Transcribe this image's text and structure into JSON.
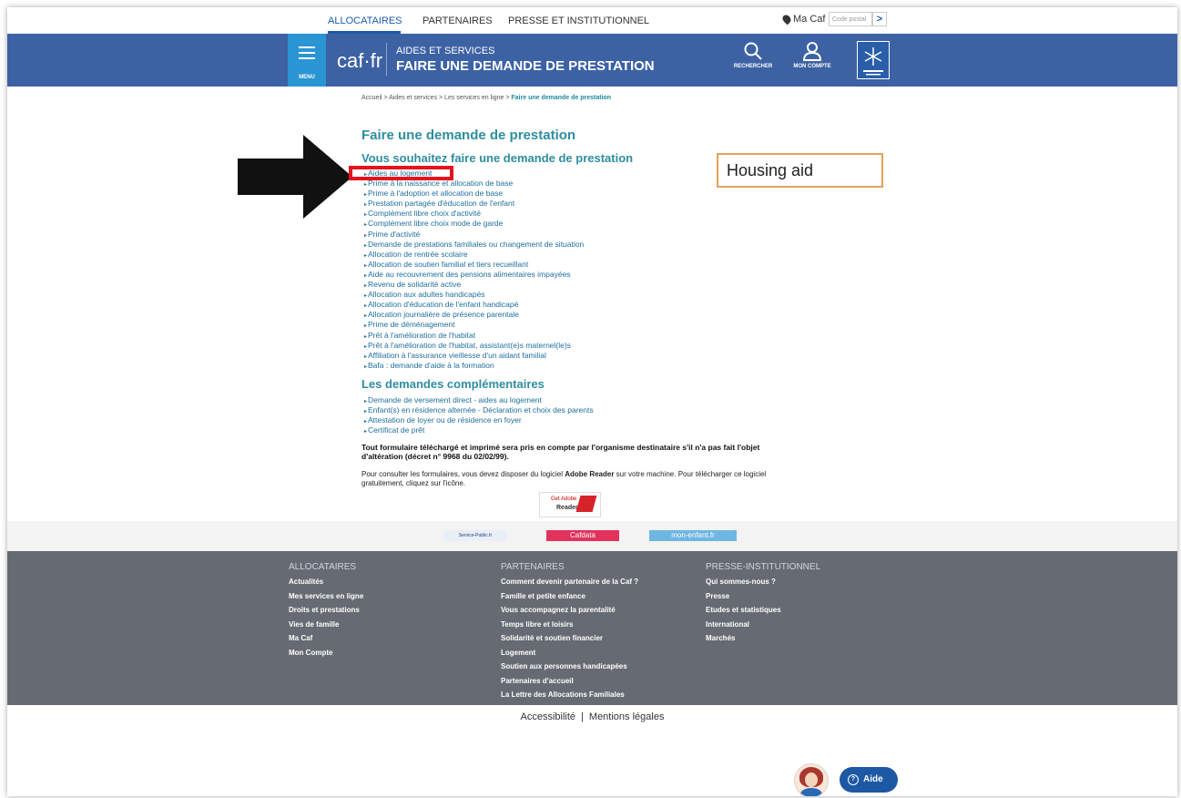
{
  "topnav": {
    "links": [
      "ALLOCATAIRES",
      "PARTENAIRES",
      "PRESSE ET INSTITUTIONNEL"
    ],
    "macaf_label": "Ma Caf",
    "postal_placeholder": "Code postal",
    "go_label": ">"
  },
  "header": {
    "menu_label": "MENU",
    "logo": "caf·fr",
    "subtitle": "AIDES ET SERVICES",
    "title": "FAIRE UNE DEMANDE DE PRESTATION",
    "search_label": "RECHERCHER",
    "account_label": "MON COMPTE"
  },
  "breadcrumb": {
    "path": "Accueil > Aides et services > Les services en ligne > ",
    "current": "Faire une demande de prestation"
  },
  "page": {
    "title": "Faire une demande de prestation",
    "section1_title": "Vous souhaitez faire une demande de prestation",
    "section1_items": [
      "Aides au logement",
      "Prime à la naissance et allocation de base",
      "Prime à l'adoption et allocation de base",
      "Prestation partagée d'éducation de l'enfant",
      "Complément libre choix d'activité",
      "Complément libre choix mode de garde",
      "Prime d'activité",
      "Demande de prestations familiales ou changement de situation",
      "Allocation de rentrée scolaire",
      "Allocation de soutien familial et tiers recueillant",
      "Aide au recouvrement des pensions alimentaires impayées",
      "Revenu de solidarité active",
      "Allocation aux adultes handicapés",
      "Allocation d'éducation de l'enfant handicapé",
      "Allocation journalière de présence parentale",
      "Prime de déménagement",
      "Prêt à l'amélioration de l'habitat",
      "Prêt à l'amélioration de l'habitat, assistant(e)s maternel(le)s",
      "Affiliation à l'assurance vieillesse d'un aidant familial",
      "Bafa : demande d'aide à la formation"
    ],
    "section2_title": "Les demandes complémentaires",
    "section2_items": [
      "Demande de versement direct - aides au logement",
      "Enfant(s) en résidence alternée - Déclaration et choix des parents",
      "Attestation de loyer ou de résidence en foyer",
      "Certificat de prêt"
    ],
    "notice": "Tout formulaire téléchargé et imprimé sera pris en compte par l'organisme destinataire s'il n'a pas fait l'objet d'altération (décret n° 9968 du 02/02/99).",
    "reader_note_1": "Pour consulter les formulaires, vous devez disposer du logiciel ",
    "reader_note_bold": "Adobe Reader",
    "reader_note_2": " sur votre machine. Pour télécharger ce logiciel gratuitement, cliquez sur l'icône.",
    "reader_badge_top": "Get Adobe",
    "reader_badge_bottom": "Reader"
  },
  "partners": {
    "service_public": "Service-Public.fr",
    "cafdata": "Cafdata",
    "monenfant": "mon-enfant.fr"
  },
  "footer": {
    "col1_title": "ALLOCATAIRES",
    "col1_links": [
      "Actualités",
      "Mes services en ligne",
      "Droits et prestations",
      "Vies de famille",
      "Ma Caf",
      "Mon Compte"
    ],
    "col2_title": "PARTENAIRES",
    "col2_links": [
      "Comment devenir partenaire de la Caf ?",
      "Famille et petite enfance",
      "Vous accompagnez la parentalité",
      "Temps libre et loisirs",
      "Solidarité et soutien financier",
      "Logement",
      "Soutien aux personnes handicapées",
      "Partenaires d'accueil",
      "La Lettre des Allocations Familiales"
    ],
    "col3_title": "PRESSE-INSTITUTIONNEL",
    "col3_links": [
      "Qui sommes-nous ?",
      "Presse",
      "Etudes et statistiques",
      "International",
      "Marchés"
    ]
  },
  "legal": {
    "accessibility": "Accessibilité",
    "separator": "|",
    "mentions": "Mentions légales"
  },
  "help": {
    "label": "Aide",
    "icon_glyph": "?"
  },
  "annotation": {
    "text": "Housing aid",
    "highlight_color": "#e5131e",
    "label_border_color": "#e3a25a"
  },
  "colors": {
    "brand_blue": "#3d62a4",
    "menu_blue": "#2a95d3",
    "title_teal": "#2e8ea0",
    "link_blue": "#1f6e9e",
    "footer_gray": "#666a72"
  }
}
